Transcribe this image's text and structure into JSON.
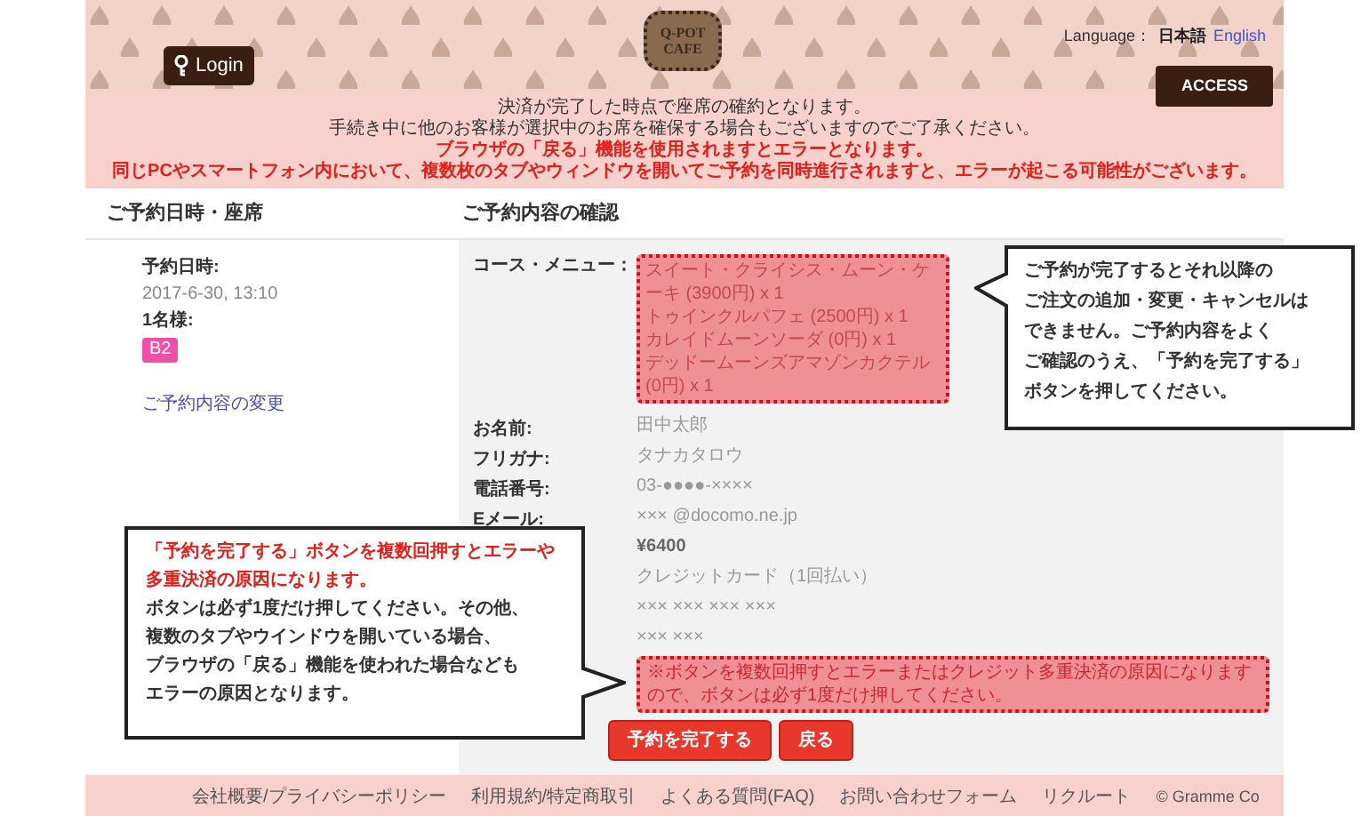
{
  "header": {
    "login_button": "Login",
    "logo": [
      "Q-POT",
      "CAFE"
    ],
    "language": {
      "label": "Language：",
      "options": [
        {
          "label": "日本語",
          "selected": true
        },
        {
          "label": "English",
          "selected": false
        }
      ]
    },
    "access_button": "ACCESS"
  },
  "notices": [
    {
      "text": "決済が完了した時点で座席の確約となります。",
      "kind": "normal"
    },
    {
      "text": "手続き中に他のお客様が選択中のお席を確保する場合もございますのでご了承ください。",
      "kind": "normal"
    },
    {
      "text": "ブラウザの「戻る」機能を使用されますとエラーとなります。",
      "kind": "warning"
    },
    {
      "text": "同じPCやスマートフォン内において、複数枚のタブやウィンドウを開いてご予約を同時進行されますと、エラーが起こる可能性がございます。",
      "kind": "warning"
    }
  ],
  "left_panel": {
    "heading": "ご予約日時・座席",
    "date_label": "予約日時:",
    "date_value": "2017-6-30, 13:10",
    "party_label": "1名様:",
    "seat": "B2",
    "change_link": "ご予約内容の変更"
  },
  "right_panel": {
    "heading": "ご予約内容の確認",
    "menu_label": "コース・メニュー：",
    "menu_items": [
      "スイート・クライシス・ムーン・ケーキ (3900円) x 1",
      "トゥインクルパフェ (2500円) x 1",
      "カレイドムーンソーダ (0円) x 1",
      "デッドームーンズアマゾンカクテル (0円) x 1"
    ],
    "rows": [
      {
        "label": "お名前:",
        "value": "田中太郎",
        "kind": "normal"
      },
      {
        "label": "フリガナ:",
        "value": "タナカタロウ",
        "kind": "normal"
      },
      {
        "label": "電話番号:",
        "value": "03-●●●●-××××",
        "kind": "normal"
      },
      {
        "label": "Eメール:",
        "value": "××× @docomo.ne.jp",
        "kind": "normal"
      },
      {
        "value": "¥6400",
        "kind": "price"
      },
      {
        "value": "クレジットカード（1回払い）",
        "kind": "normal"
      },
      {
        "value": "××× ××× ××× ×××",
        "kind": "normal"
      },
      {
        "value": "××× ×××",
        "kind": "normal"
      }
    ],
    "warning": "※ボタンを複数回押すとエラーまたはクレジット多重決済の原因になりますので、ボタンは必ず1度だけ押してください。",
    "buttons": [
      "予約を完了する",
      "戻る"
    ]
  },
  "callouts": [
    {
      "lines": [
        {
          "text": "ご予約が完了するとそれ以降の",
          "kind": "normal"
        },
        {
          "text": "ご注文の追加・変更・キャンセルは",
          "kind": "normal"
        },
        {
          "text": "できません。ご予約内容をよく",
          "kind": "normal"
        },
        {
          "text": "ご確認のうえ、「予約を完了する」",
          "kind": "normal"
        },
        {
          "text": "ボタンを押してください。",
          "kind": "normal"
        }
      ]
    },
    {
      "lines": [
        {
          "text": "「予約を完了する」ボタンを複数回押すとエラーや",
          "kind": "warning"
        },
        {
          "text": "多重決済の原因になります。",
          "kind": "warning"
        },
        {
          "text": "ボタンは必ず1度だけ押してください。その他、",
          "kind": "normal"
        },
        {
          "text": "複数のタブやウインドウを開いている場合、",
          "kind": "normal"
        },
        {
          "text": "ブラウザの「戻る」機能を使われた場合なども",
          "kind": "normal"
        },
        {
          "text": "エラーの原因となります。",
          "kind": "normal"
        }
      ]
    }
  ],
  "footer": {
    "links": [
      "会社概要/プライバシーポリシー",
      "利用規約/特定商取引",
      "よくある質問(FAQ)",
      "お問い合わせフォーム",
      "リクルート"
    ],
    "copyright": "© Gramme Co"
  }
}
